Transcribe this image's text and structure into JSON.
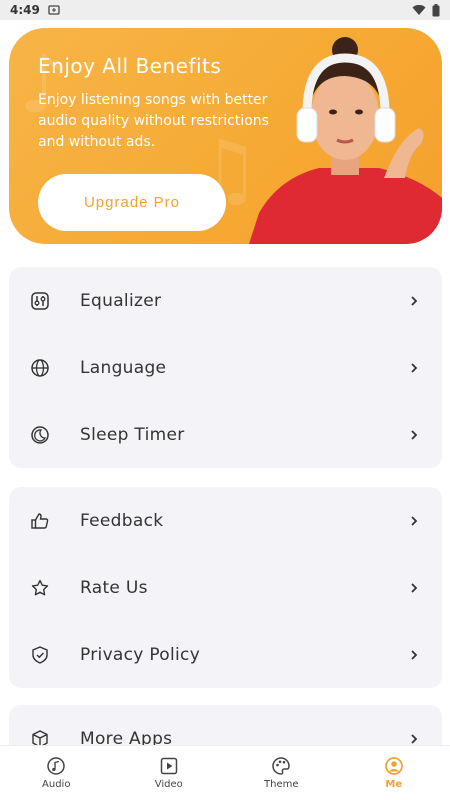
{
  "status": {
    "time": "4:49"
  },
  "banner": {
    "title": "Enjoy All Benefits",
    "description": "Enjoy listening songs with better audio quality without restrictions and without ads.",
    "button": "Upgrade Pro"
  },
  "settings_group_1": [
    {
      "label": "Equalizer",
      "icon": "equalizer-icon"
    },
    {
      "label": "Language",
      "icon": "globe-icon"
    },
    {
      "label": "Sleep Timer",
      "icon": "moon-icon"
    }
  ],
  "settings_group_2": [
    {
      "label": "Feedback",
      "icon": "thumbs-up-icon"
    },
    {
      "label": "Rate Us",
      "icon": "star-icon"
    },
    {
      "label": "Privacy Policy",
      "icon": "shield-icon"
    }
  ],
  "settings_group_3": [
    {
      "label": "More Apps",
      "icon": "box-icon"
    }
  ],
  "tabs": [
    {
      "label": "Audio",
      "icon": "music-icon",
      "active": false
    },
    {
      "label": "Video",
      "icon": "video-icon",
      "active": false
    },
    {
      "label": "Theme",
      "icon": "palette-icon",
      "active": false
    },
    {
      "label": "Me",
      "icon": "user-icon",
      "active": true
    }
  ],
  "colors": {
    "accent": "#f0a237",
    "banner": "#f6a934",
    "card": "#f4f4f8"
  }
}
